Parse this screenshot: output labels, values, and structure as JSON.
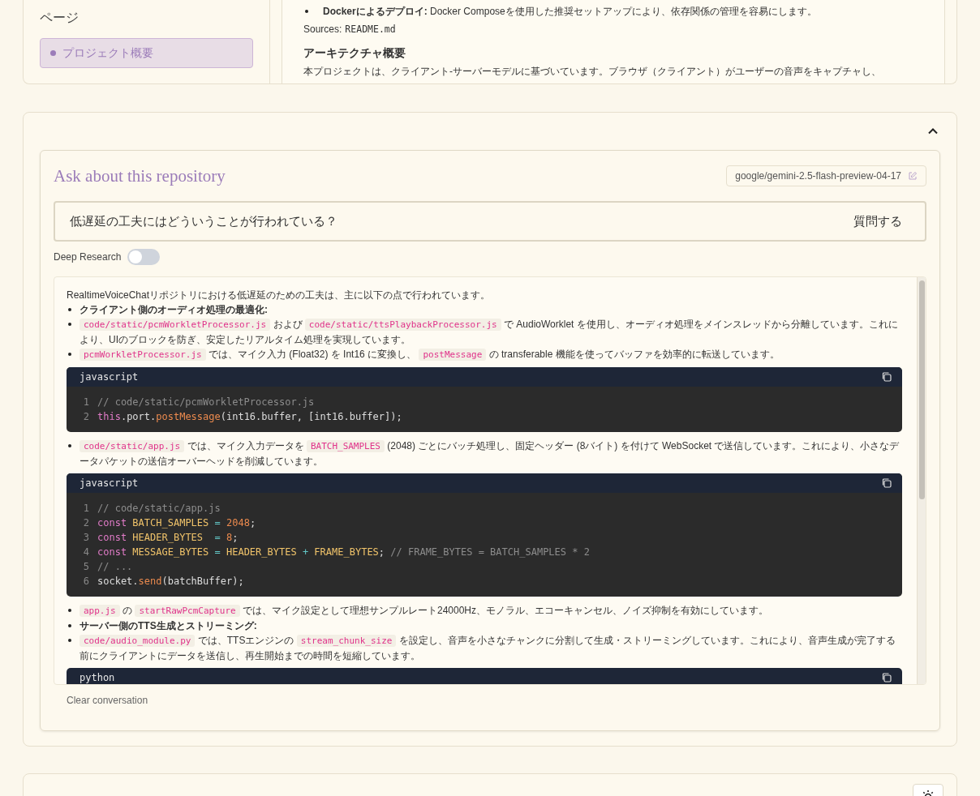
{
  "sidebar": {
    "heading": "ページ",
    "items": [
      {
        "label": "プロジェクト概要",
        "selected": true
      }
    ]
  },
  "doc": {
    "blocks": [
      {
        "kind": "bullet",
        "text": "**Dockerによるデプロイ:** Docker Composeを使用した推奨セットアップにより、依存関係の管理を容易にします。"
      },
      {
        "kind": "sources",
        "label": "Sources:",
        "file": "README.md"
      },
      {
        "kind": "heading",
        "text": "アーキテクチャ概要"
      },
      {
        "kind": "para",
        "text": "本プロジェクトは、クライアント-サーバーモデルに基づいています。ブラウザ（クライアント）がユーザーの音声をキャプチャし、"
      }
    ]
  },
  "ask": {
    "title": "Ask about this repository",
    "model": "google/gemini-2.5-flash-preview-04-17",
    "question": "低遅延の工夫にはどういうことが行われている？",
    "submit": "質問する",
    "deep_research": {
      "label": "Deep Research",
      "on": false
    },
    "answer": [
      {
        "kind": "para",
        "parts": [
          {
            "kind": "text",
            "text": "RealtimeVoiceChatリポジトリにおける低遅延のための工夫は、主に以下の点で行われています。"
          }
        ]
      },
      {
        "kind": "bold-bullet",
        "parts": [
          {
            "kind": "text",
            "text": "クライアント側のオーディオ処理の最適化:"
          }
        ]
      },
      {
        "kind": "bullet",
        "parts": [
          {
            "kind": "code",
            "text": "code/static/pcmWorkletProcessor.js"
          },
          {
            "kind": "text",
            "text": " および "
          },
          {
            "kind": "code",
            "text": "code/static/ttsPlaybackProcessor.js"
          },
          {
            "kind": "text",
            "text": " で AudioWorklet を使用し、オーディオ処理をメインスレッドから分離しています。これにより、UIのブロックを防ぎ、安定したリアルタイム処理を実現しています。"
          }
        ]
      },
      {
        "kind": "bullet",
        "parts": [
          {
            "kind": "code",
            "text": "pcmWorkletProcessor.js"
          },
          {
            "kind": "text",
            "text": " では、マイク入力 (Float32) を Int16 に変換し、 "
          },
          {
            "kind": "code",
            "text": "postMessage"
          },
          {
            "kind": "text",
            "text": " の transferable 機能を使ってバッファを効率的に転送しています。"
          }
        ]
      },
      {
        "kind": "code",
        "language": "javascript",
        "lines": [
          {
            "number": "1",
            "tokens": [
              {
                "kind": "comment",
                "text": "// code/static/pcmWorkletProcessor.js"
              }
            ]
          },
          {
            "number": "2",
            "tokens": [
              {
                "kind": "keyword",
                "text": "this"
              },
              {
                "kind": "plain",
                "text": ".port."
              },
              {
                "kind": "func",
                "text": "postMessage"
              },
              {
                "kind": "plain",
                "text": "(int16.buffer, [int16.buffer]);"
              }
            ]
          }
        ]
      },
      {
        "kind": "bullet",
        "parts": [
          {
            "kind": "code",
            "text": "code/static/app.js"
          },
          {
            "kind": "text",
            "text": " では、マイク入力データを "
          },
          {
            "kind": "code",
            "text": "BATCH_SAMPLES"
          },
          {
            "kind": "text",
            "text": " (2048) ごとにバッチ処理し、固定ヘッダー (8バイト) を付けて WebSocket で送信しています。これにより、小さなデータパケットの送信オーバーヘッドを削減しています。"
          }
        ]
      },
      {
        "kind": "code",
        "language": "javascript",
        "lines": [
          {
            "number": "1",
            "tokens": [
              {
                "kind": "comment",
                "text": "// code/static/app.js"
              }
            ]
          },
          {
            "number": "2",
            "tokens": [
              {
                "kind": "keyword",
                "text": "const "
              },
              {
                "kind": "ident",
                "text": "BATCH_SAMPLES"
              },
              {
                "kind": "op",
                "text": " = "
              },
              {
                "kind": "number",
                "text": "2048"
              },
              {
                "kind": "plain",
                "text": ";"
              }
            ]
          },
          {
            "number": "3",
            "tokens": [
              {
                "kind": "keyword",
                "text": "const "
              },
              {
                "kind": "ident",
                "text": "HEADER_BYTES"
              },
              {
                "kind": "op",
                "text": "  = "
              },
              {
                "kind": "number",
                "text": "8"
              },
              {
                "kind": "plain",
                "text": ";"
              }
            ]
          },
          {
            "number": "4",
            "tokens": [
              {
                "kind": "keyword",
                "text": "const "
              },
              {
                "kind": "ident",
                "text": "MESSAGE_BYTES"
              },
              {
                "kind": "op",
                "text": " = "
              },
              {
                "kind": "ident",
                "text": "HEADER_BYTES"
              },
              {
                "kind": "op",
                "text": " + "
              },
              {
                "kind": "ident",
                "text": "FRAME_BYTES"
              },
              {
                "kind": "plain",
                "text": "; "
              },
              {
                "kind": "comment",
                "text": "// FRAME_BYTES = BATCH_SAMPLES * 2"
              }
            ]
          },
          {
            "number": "5",
            "tokens": [
              {
                "kind": "comment",
                "text": "// ..."
              }
            ]
          },
          {
            "number": "6",
            "tokens": [
              {
                "kind": "plain",
                "text": "socket."
              },
              {
                "kind": "func",
                "text": "send"
              },
              {
                "kind": "plain",
                "text": "(batchBuffer);"
              }
            ]
          }
        ]
      },
      {
        "kind": "bullet",
        "parts": [
          {
            "kind": "code",
            "text": "app.js"
          },
          {
            "kind": "text",
            "text": " の "
          },
          {
            "kind": "code",
            "text": "startRawPcmCapture"
          },
          {
            "kind": "text",
            "text": " では、マイク設定として理想サンプルレート24000Hz、モノラル、エコーキャンセル、ノイズ抑制を有効にしています。"
          }
        ]
      },
      {
        "kind": "bold-bullet",
        "parts": [
          {
            "kind": "text",
            "text": "サーバー側のTTS生成とストリーミング:"
          }
        ]
      },
      {
        "kind": "bullet",
        "parts": [
          {
            "kind": "code",
            "text": "code/audio_module.py"
          },
          {
            "kind": "text",
            "text": " では、TTSエンジンの "
          },
          {
            "kind": "code",
            "text": "stream_chunk_size"
          },
          {
            "kind": "text",
            "text": " を設定し、音声を小さなチャンクに分割して生成・ストリーミングしています。これにより、音声生成が完了する前にクライアントにデータを送信し、再生開始までの時間を短縮しています。"
          }
        ]
      },
      {
        "kind": "code",
        "language": "python"
      }
    ],
    "clear": "Clear conversation"
  }
}
